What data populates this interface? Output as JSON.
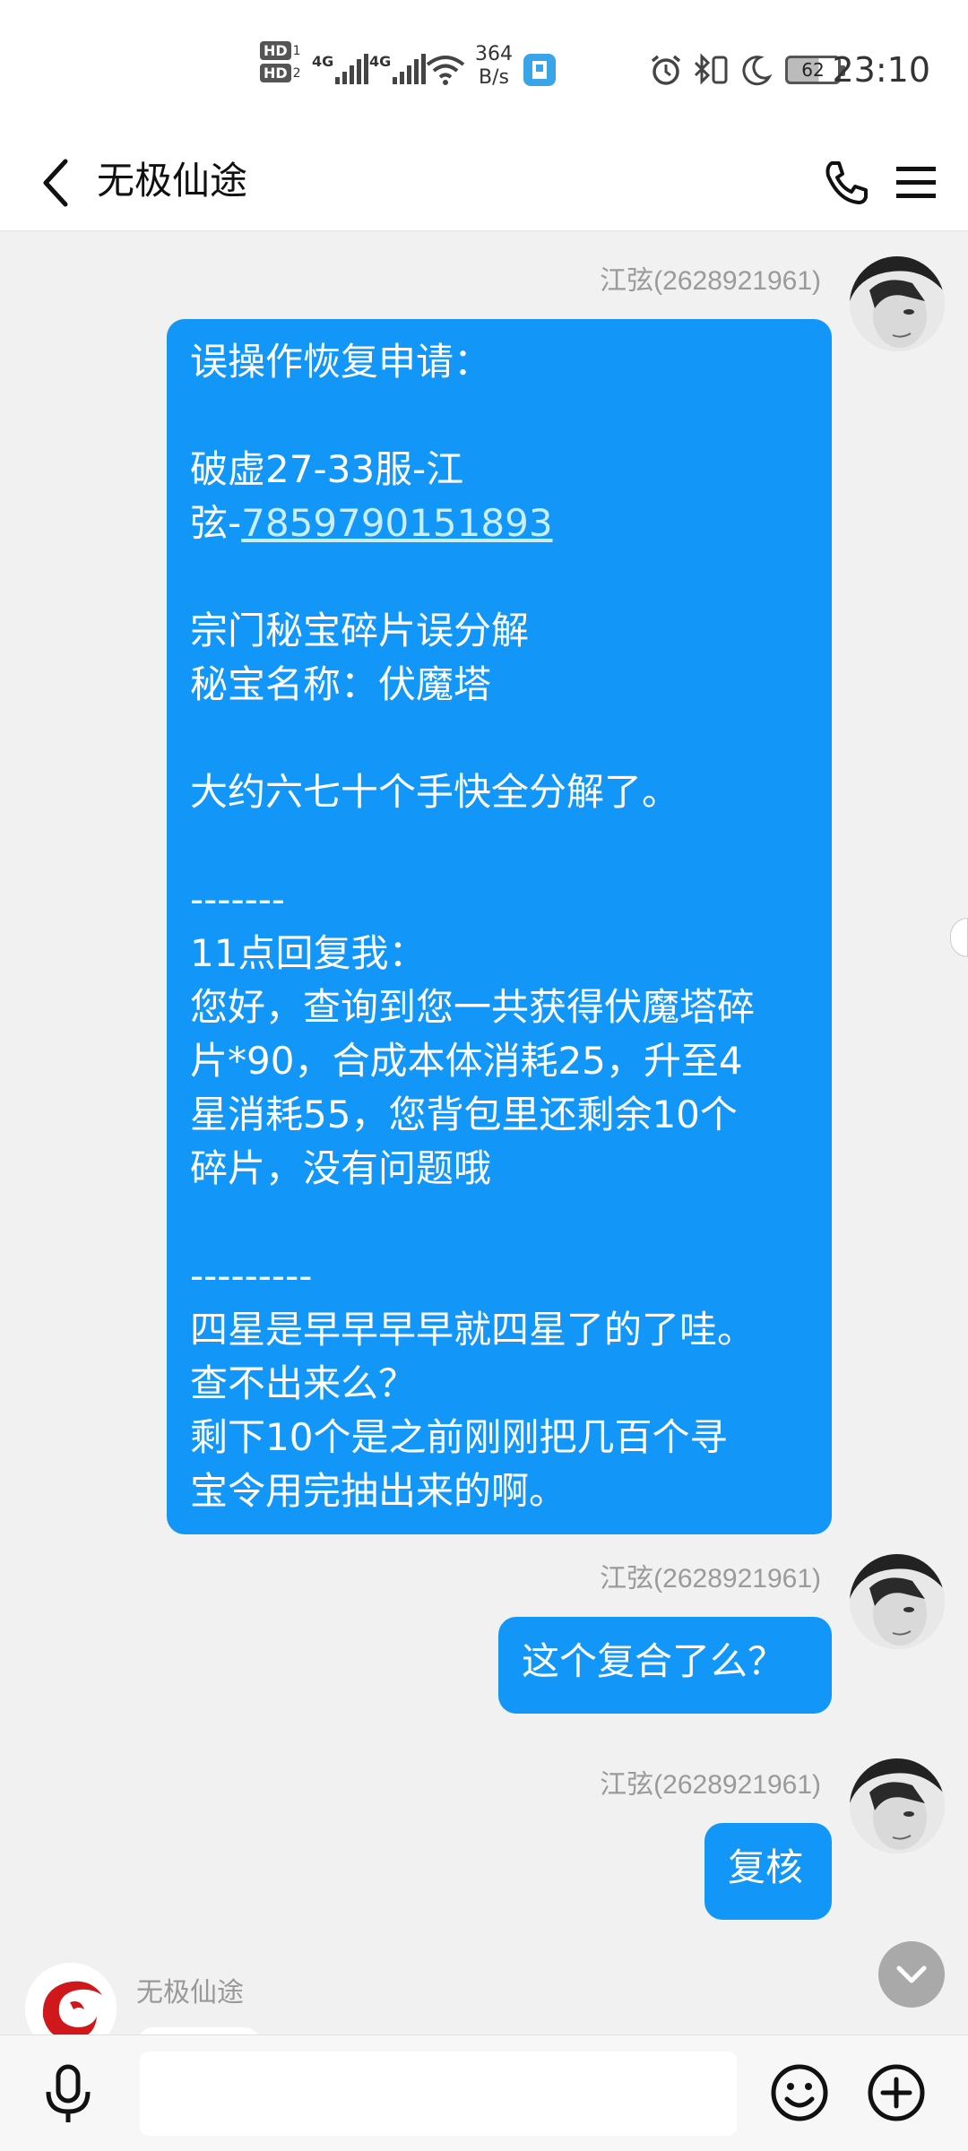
{
  "status_bar": {
    "hd1": "HD",
    "hd1_sub": "1",
    "hd2": "HD",
    "hd2_sub": "2",
    "net1": "4G",
    "net2": "4G",
    "speed_value": "364",
    "speed_unit": "B/s",
    "battery": "62",
    "time": "23:10"
  },
  "header": {
    "title": "无极仙途",
    "icons": [
      "back-arrow-icon",
      "phone-icon",
      "menu-icon"
    ]
  },
  "messages": [
    {
      "sender": "江弦(2628921961)",
      "lines": [
        "误操作恢复申请：",
        "",
        "破虚27-33服-江",
        "弦-{link}",
        "",
        "宗门秘宝碎片误分解",
        "秘宝名称：伏魔塔",
        "",
        "大约六七十个手快全分解了。",
        "",
        "-------",
        "11点回复我：",
        "您好，查询到您一共获得伏魔塔碎",
        "片*90，合成本体消耗25，升至4",
        "星消耗55，您背包里还剩余10个",
        "碎片，没有问题哦",
        "",
        "---------",
        "四星是早早早早就四星了的了哇。",
        "查不出来么？",
        "剩下10个是之前刚刚把几百个寻",
        "宝令用完抽出来的啊。"
      ],
      "link_text": "7859790151893"
    },
    {
      "sender": "江弦(2628921961)",
      "text": "这个复合了么？"
    },
    {
      "sender": "江弦(2628921961)",
      "text": "复核"
    }
  ],
  "bot": {
    "name": "无极仙途"
  },
  "input": {
    "value": "",
    "placeholder": ""
  },
  "colors": {
    "bubble": "#1296f7",
    "link": "#c9efff",
    "background": "#f1f1f1"
  }
}
